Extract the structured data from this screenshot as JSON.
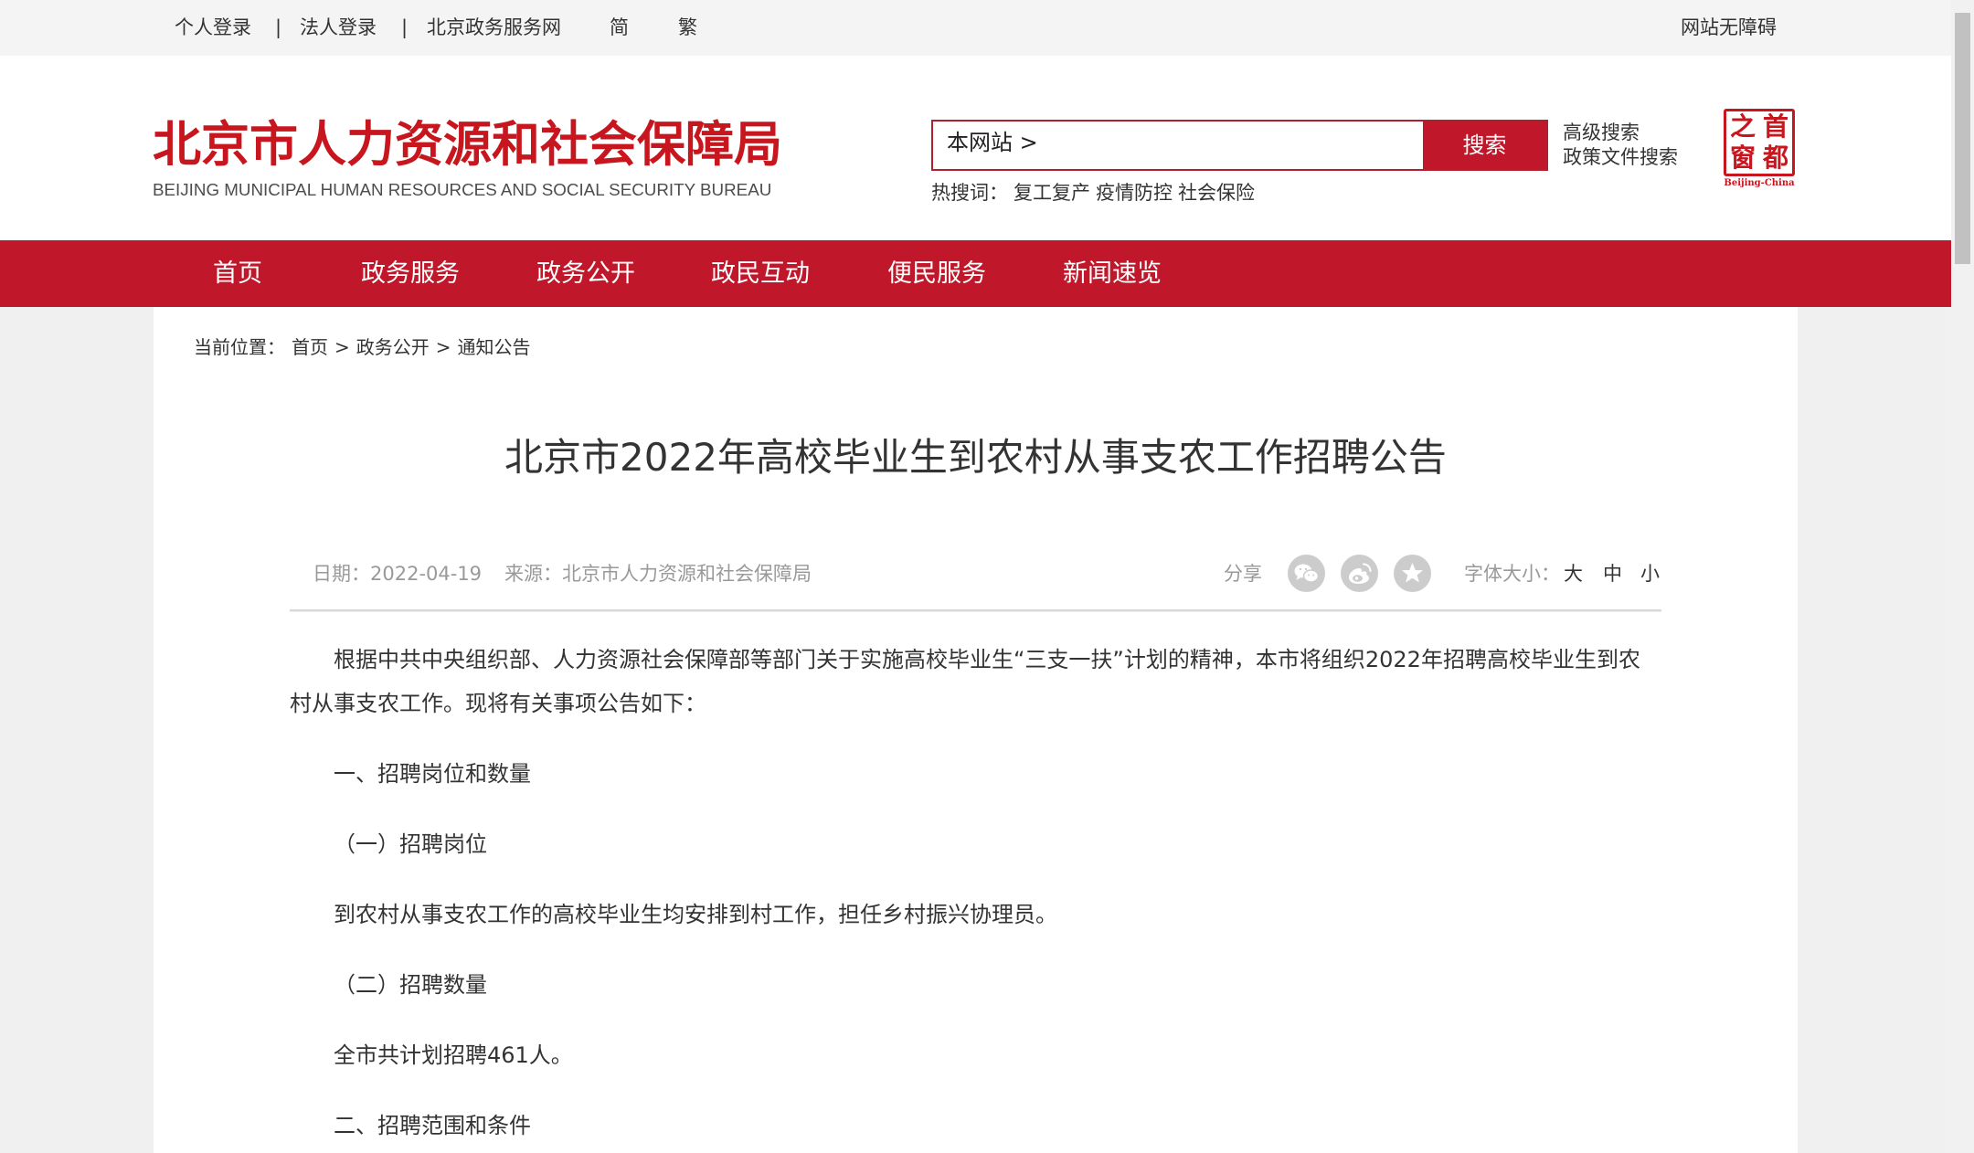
{
  "top_bar": {
    "links": [
      "个人登录",
      "法人登录",
      "北京政务服务网"
    ],
    "separator": "|",
    "lang_simplified": "简",
    "lang_traditional": "繁",
    "accessibility": "网站无障碍"
  },
  "header": {
    "title": "北京市人力资源和社会保障局",
    "subtitle": "BEIJING MUNICIPAL HUMAN RESOURCES AND SOCIAL SECURITY BUREAU",
    "search": {
      "scope": "本网站 >",
      "button": "搜索"
    },
    "advanced_search": "高级搜索",
    "policy_search": "政策文件搜索",
    "hot_label": "热搜词：",
    "hot_words": [
      "复工复产",
      "疫情防控",
      "社会保险"
    ],
    "portal_logo": {
      "chars": [
        "之",
        "首",
        "窗",
        "都"
      ],
      "caption": "Beijing-China"
    }
  },
  "nav": {
    "items": [
      "首页",
      "政务服务",
      "政务公开",
      "政民互动",
      "便民服务",
      "新闻速览"
    ]
  },
  "breadcrumb": {
    "label": "当前位置：",
    "items": [
      "首页",
      "政务公开",
      "通知公告"
    ],
    "separator": ">"
  },
  "article": {
    "title": "北京市2022年高校毕业生到农村从事支农工作招聘公告",
    "date": "日期：2022-04-19",
    "source": "来源：北京市人力资源和社会保障局",
    "share": {
      "label": "分享",
      "icons": [
        "wechat-icon",
        "weibo-icon",
        "favorite-icon"
      ]
    },
    "font_size": {
      "label": "字体大小：",
      "options": [
        "大",
        "中",
        "小"
      ]
    },
    "paragraphs": [
      "根据中共中央组织部、人力资源社会保障部等部门关于实施高校毕业生“三支一扶”计划的精神，本市将组织2022年招聘高校毕业生到农村从事支农工作。现将有关事项公告如下：",
      "一、招聘岗位和数量",
      "（一）招聘岗位",
      "到农村从事支农工作的高校毕业生均安排到村工作，担任乡村振兴协理员。",
      "（二）招聘数量",
      "全市共计划招聘461人。",
      "二、招聘范围和条件"
    ]
  },
  "colors": {
    "brand_red": "#c0172b",
    "title_red": "#c8161e",
    "text": "#333333",
    "muted": "#999999",
    "page_background": "#f0f0f0"
  }
}
